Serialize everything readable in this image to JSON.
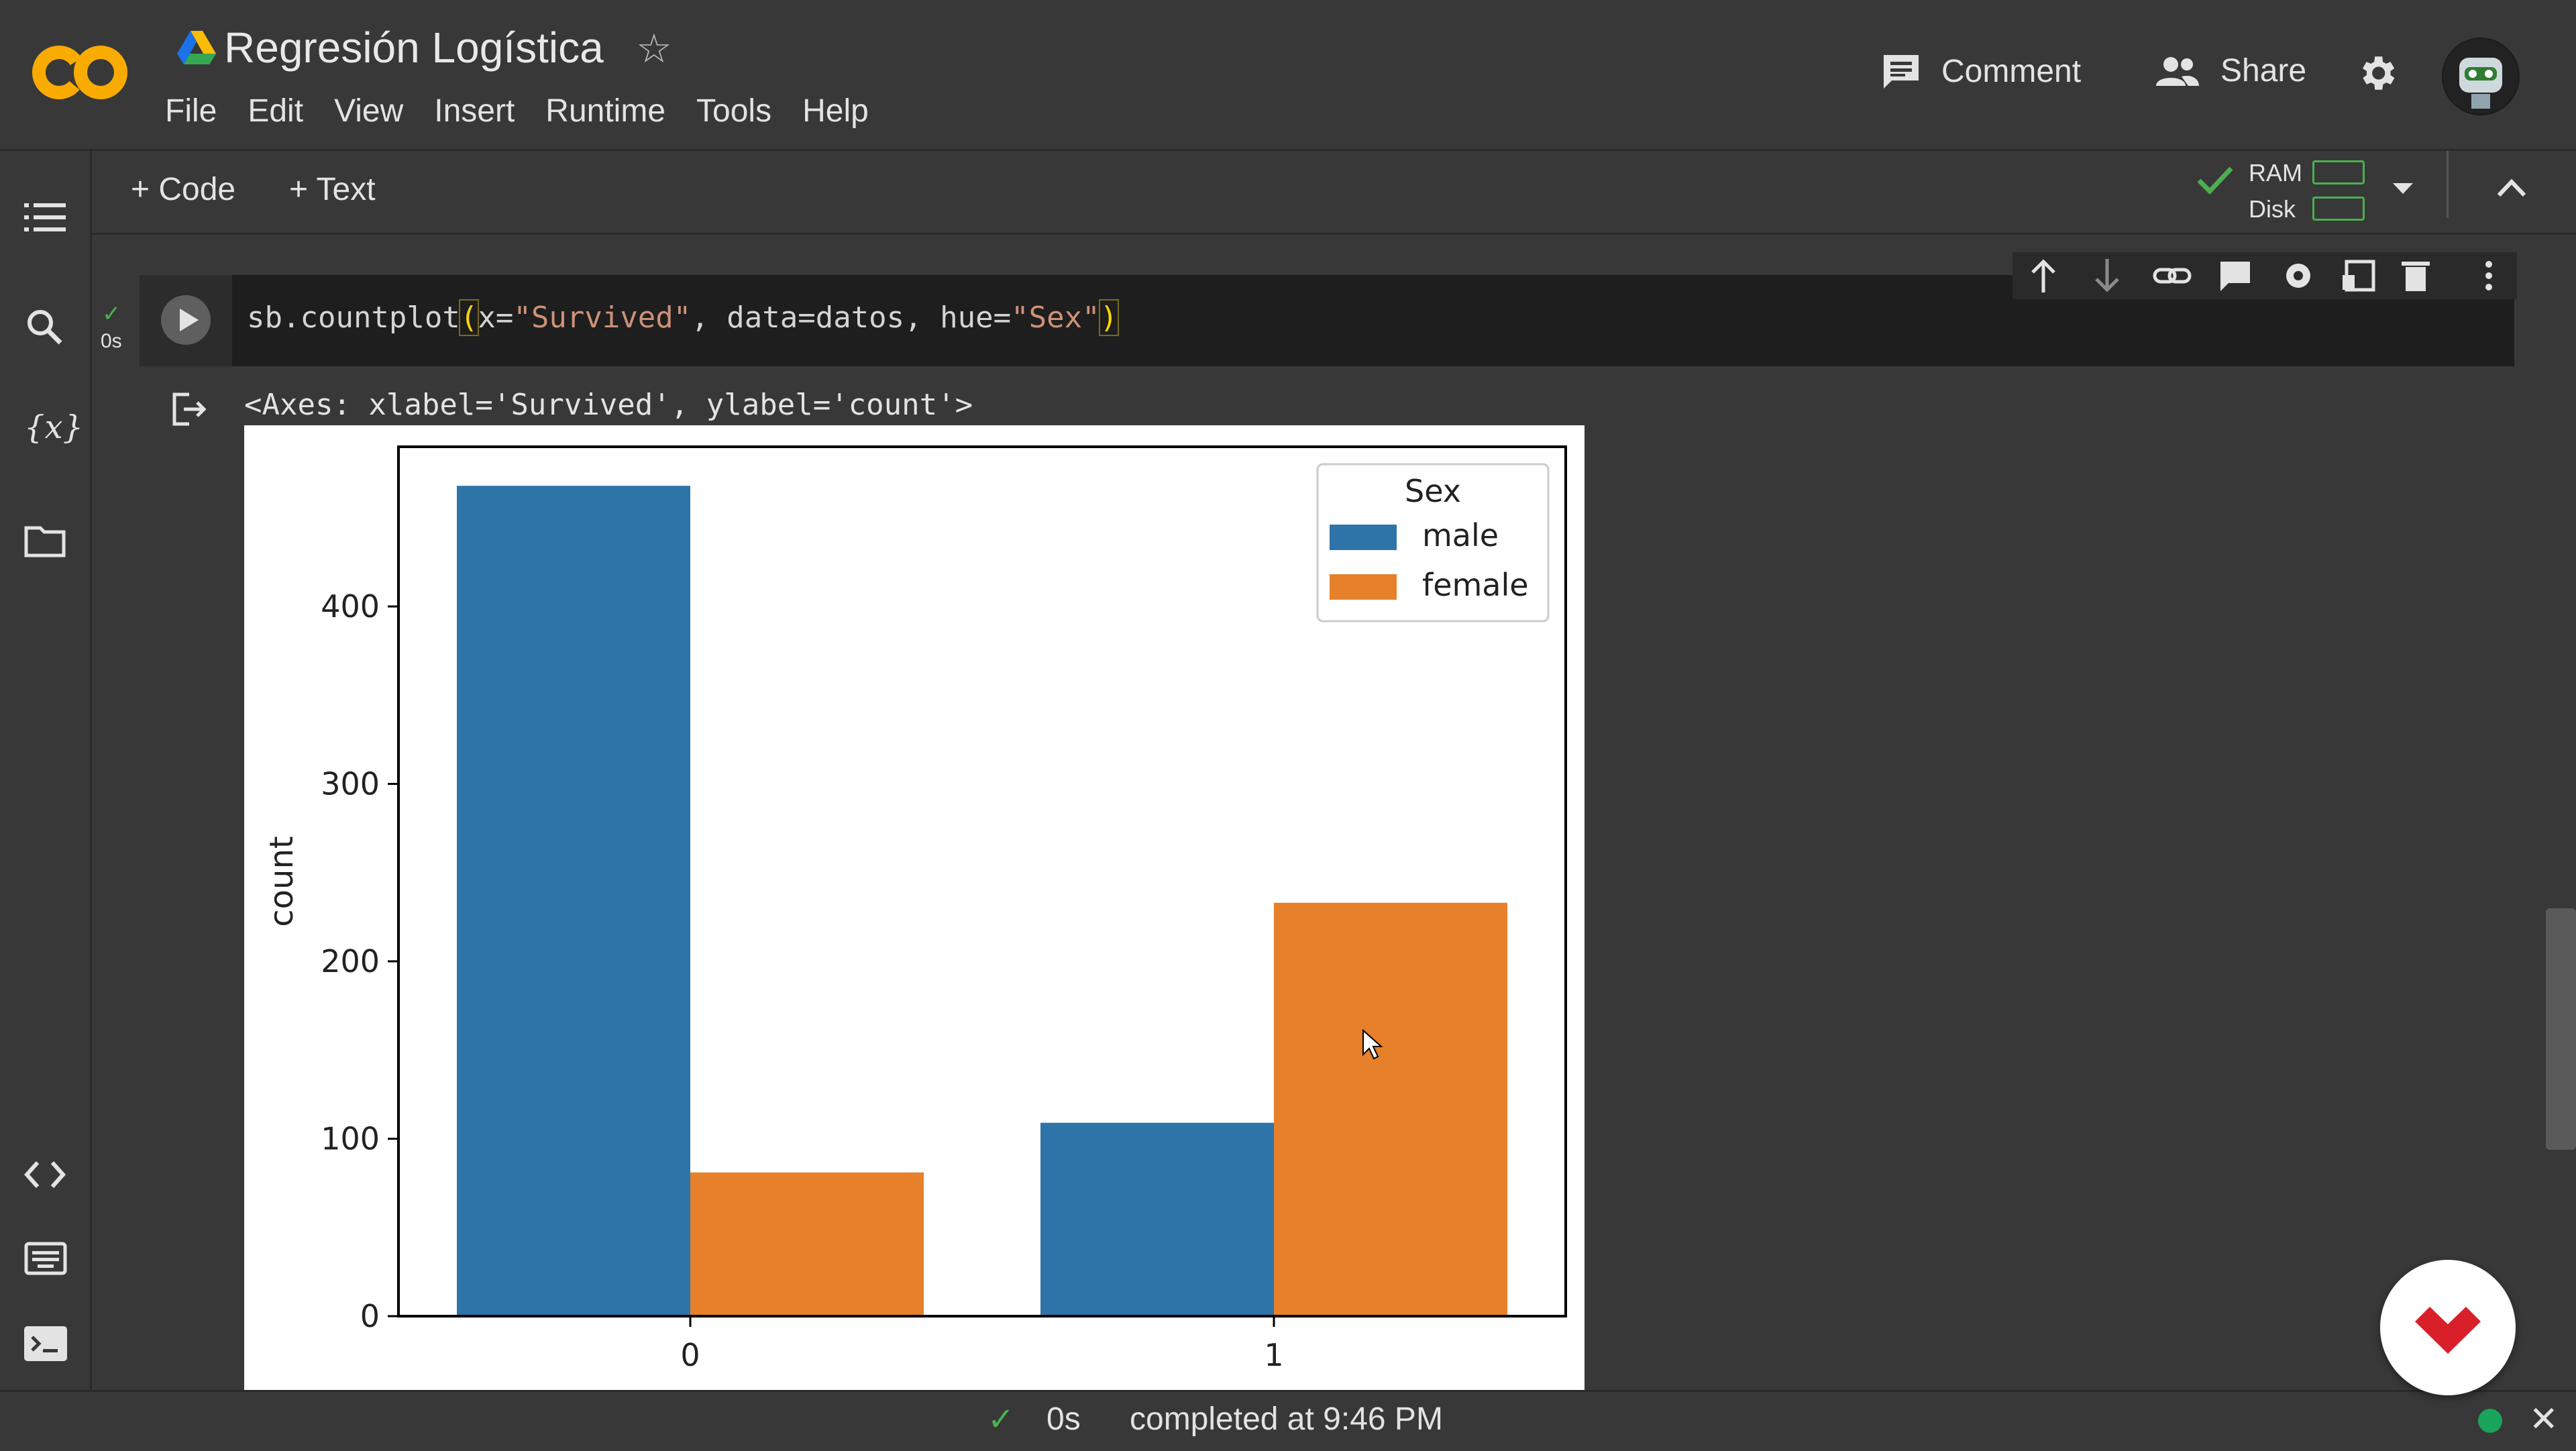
{
  "header": {
    "title": "Regresión Logística",
    "menu": [
      "File",
      "Edit",
      "View",
      "Insert",
      "Runtime",
      "Tools",
      "Help"
    ],
    "comment_label": "Comment",
    "share_label": "Share"
  },
  "toolbar": {
    "add_code": "+ Code",
    "add_text": "+ Text",
    "ram_label": "RAM",
    "disk_label": "Disk"
  },
  "cell": {
    "exec_time": "0s",
    "code_fn": "sb.countplot",
    "code_open": "(",
    "code_arg1": "x=",
    "code_arg1_val": "\"Survived\"",
    "code_arg2": ", data=datos, hue=",
    "code_arg3_val": "\"Sex\"",
    "code_close": ")",
    "output_repr": "<Axes: xlabel='Survived', ylabel='count'>"
  },
  "status": {
    "time": "0s",
    "text": "completed at 9:46 PM"
  },
  "colors": {
    "male": "#2f74a8",
    "female": "#e6802a",
    "accent_green": "#4caf50",
    "fab_red": "#d81f2a"
  },
  "chart_data": {
    "type": "bar",
    "categories": [
      "0",
      "1"
    ],
    "series": [
      {
        "name": "male",
        "values": [
          468,
          109
        ]
      },
      {
        "name": "female",
        "values": [
          81,
          233
        ]
      }
    ],
    "ylabel": "count",
    "ylim": [
      0,
      490
    ],
    "yticks": [
      0,
      100,
      200,
      300,
      400
    ],
    "legend_title": "Sex",
    "legend_position": "top-right",
    "grid": false
  }
}
